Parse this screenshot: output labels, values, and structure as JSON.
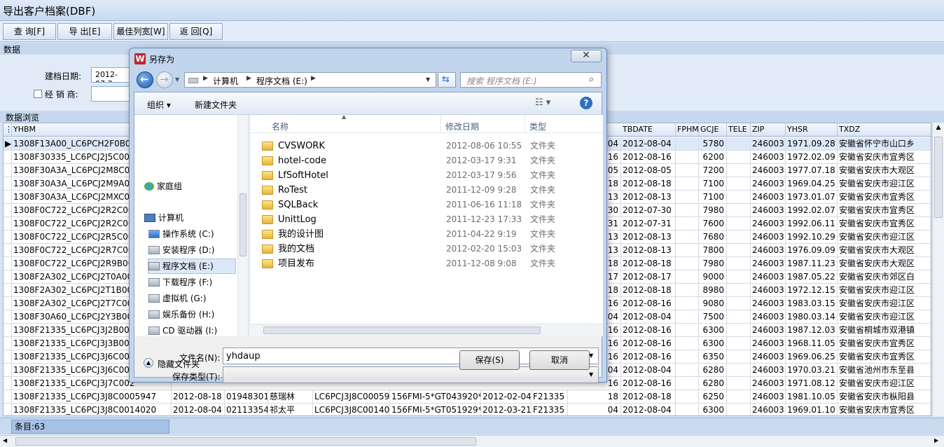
{
  "window": {
    "title": "导出客户档案(DBF)"
  },
  "toolbar": {
    "query_label": "查    询[F]",
    "export_label": "导    出[E]",
    "best_width_label": "最佳列宽[W]",
    "back_label": "返    回[Q]"
  },
  "data_section": {
    "title": "数据",
    "date_label": "建档日期:",
    "date_value": "2012-07-2",
    "dealer_label": "经 销 商:",
    "dealer_checked": false
  },
  "browse_section": {
    "title": "数据浏览"
  },
  "grid": {
    "left_columns": [
      "YHBM"
    ],
    "right_columns": [
      "TBDATE",
      "FPHM",
      "GCJE",
      "TELE",
      "ZIP",
      "YHSR",
      "TXDZ"
    ],
    "rows": [
      {
        "yhbm": "1308F13A00_LC6PCH2F0B001",
        "tb_tail": "04",
        "tbdate": "2012-08-04",
        "fphm": "",
        "gcje": "5780",
        "tele": "",
        "zip": "246003",
        "yhsr": "1971.09.28",
        "txdz": "安徽省怀宁市山口乡",
        "selected": true
      },
      {
        "yhbm": "1308F30335_LC6PCJ2J5C002",
        "tb_tail": "16",
        "tbdate": "2012-08-16",
        "fphm": "",
        "gcje": "6200",
        "tele": "",
        "zip": "246003",
        "yhsr": "1972.02.09",
        "txdz": "安徽省安庆市宜秀区"
      },
      {
        "yhbm": "1308F30A3A_LC6PCJ2M8C001",
        "tb_tail": "05",
        "tbdate": "2012-08-05",
        "fphm": "",
        "gcje": "7200",
        "tele": "",
        "zip": "246003",
        "yhsr": "1977.07.18",
        "txdz": "安徽省安庆市大观区"
      },
      {
        "yhbm": "1308F30A3A_LC6PCJ2M9A000",
        "tb_tail": "18",
        "tbdate": "2012-08-18",
        "fphm": "",
        "gcje": "7100",
        "tele": "",
        "zip": "246003",
        "yhsr": "1969.04.25",
        "txdz": "安徽省安庆市迎江区"
      },
      {
        "yhbm": "1308F30A3A_LC6PCJ2MXC001",
        "tb_tail": "13",
        "tbdate": "2012-08-13",
        "fphm": "",
        "gcje": "7100",
        "tele": "",
        "zip": "246003",
        "yhsr": "1973.01.07",
        "txdz": "安徽省安庆市宜秀区"
      },
      {
        "yhbm": "1308F0C722_LC6PCJ2R2C001",
        "tb_tail": "30",
        "tbdate": "2012-07-30",
        "fphm": "",
        "gcje": "7980",
        "tele": "",
        "zip": "246003",
        "yhsr": "1992.02.07",
        "txdz": "安徽省安庆市宜秀区"
      },
      {
        "yhbm": "1308F0C722_LC6PCJ2R2C001",
        "tb_tail": "31",
        "tbdate": "2012-07-31",
        "fphm": "",
        "gcje": "7600",
        "tele": "",
        "zip": "246003",
        "yhsr": "1992.06.11",
        "txdz": "安徽省安庆市宜秀区"
      },
      {
        "yhbm": "1308F0C722_LC6PCJ2R5C001",
        "tb_tail": "13",
        "tbdate": "2012-08-13",
        "fphm": "",
        "gcje": "7680",
        "tele": "",
        "zip": "246003",
        "yhsr": "1992.10.29",
        "txdz": "安徽省安庆市迎江区"
      },
      {
        "yhbm": "1308F0C722_LC6PCJ2R7C001",
        "tb_tail": "13",
        "tbdate": "2012-08-13",
        "fphm": "",
        "gcje": "7800",
        "tele": "",
        "zip": "246003",
        "yhsr": "1976.09.09",
        "txdz": "安徽省安庆市大观区"
      },
      {
        "yhbm": "1308F0C722_LC6PCJ2R9B005",
        "tb_tail": "18",
        "tbdate": "2012-08-18",
        "fphm": "",
        "gcje": "7980",
        "tele": "",
        "zip": "246003",
        "yhsr": "1987.11.23",
        "txdz": "安徽省安庆市大观区"
      },
      {
        "yhbm": "1308F2A302_LC6PCJ2T0A000",
        "tb_tail": "17",
        "tbdate": "2012-08-17",
        "fphm": "",
        "gcje": "9000",
        "tele": "",
        "zip": "246003",
        "yhsr": "1987.05.22",
        "txdz": "安徽省安庆市郊区白"
      },
      {
        "yhbm": "1308F2A302_LC6PCJ2T1B000",
        "tb_tail": "18",
        "tbdate": "2012-08-18",
        "fphm": "",
        "gcje": "8980",
        "tele": "",
        "zip": "246003",
        "yhsr": "1972.12.15",
        "txdz": "安徽省安庆市迎江区"
      },
      {
        "yhbm": "1308F2A302_LC6PCJ2T7C000",
        "tb_tail": "16",
        "tbdate": "2012-08-16",
        "fphm": "",
        "gcje": "9080",
        "tele": "",
        "zip": "246003",
        "yhsr": "1983.03.15",
        "txdz": "安徽省安庆市迎江区"
      },
      {
        "yhbm": "1308F30A60_LC6PCJ2Y3B004",
        "tb_tail": "04",
        "tbdate": "2012-08-04",
        "fphm": "",
        "gcje": "7500",
        "tele": "",
        "zip": "246003",
        "yhsr": "1980.03.14",
        "txdz": "安徽省安庆市迎江区"
      },
      {
        "yhbm": "1308F21335_LC6PCJ3J2B003",
        "tb_tail": "16",
        "tbdate": "2012-08-16",
        "fphm": "",
        "gcje": "6300",
        "tele": "",
        "zip": "246003",
        "yhsr": "1987.12.03",
        "txdz": "安徽省桐城市双港镇"
      },
      {
        "yhbm": "1308F21335_LC6PCJ3J3B003",
        "tb_tail": "16",
        "tbdate": "2012-08-16",
        "fphm": "",
        "gcje": "6300",
        "tele": "",
        "zip": "246003",
        "yhsr": "1968.11.05",
        "txdz": "安徽省安庆市宜秀区"
      },
      {
        "yhbm": "1308F21335_LC6PCJ3J6C000",
        "tb_tail": "16",
        "tbdate": "2012-08-16",
        "fphm": "",
        "gcje": "6350",
        "tele": "",
        "zip": "246003",
        "yhsr": "1969.06.25",
        "txdz": "安徽省安庆市宜秀区"
      },
      {
        "yhbm": "1308F21335_LC6PCJ3J6C000",
        "tb_tail": "04",
        "tbdate": "2012-08-04",
        "fphm": "",
        "gcje": "6280",
        "tele": "",
        "zip": "246003",
        "yhsr": "1970.03.21",
        "txdz": "安徽省池州市东至县"
      },
      {
        "yhbm": "1308F21335_LC6PCJ3J7C002",
        "tb_tail": "16",
        "tbdate": "2012-08-16",
        "fphm": "",
        "gcje": "6280",
        "tele": "",
        "zip": "246003",
        "yhsr": "1971.08.12",
        "txdz": "安徽省安庆市迎江区"
      },
      {
        "yhbm": "1308F21335_LC6PCJ3J8C0005947",
        "mid": [
          "2012-08-18",
          "01948301",
          "慈瑞林",
          "LC6PCJ3J8C0005947",
          "156FMI-5*GT043920*",
          "2012-02-04",
          "F21335"
        ],
        "tb_tail": "18",
        "tbdate": "2012-08-18",
        "fphm": "",
        "gcje": "6250",
        "tele": "",
        "zip": "246003",
        "yhsr": "1981.10.05",
        "txdz": "安徽省安庆市枞阳县"
      },
      {
        "yhbm": "1308F21335_LC6PCJ3J8C0014020",
        "mid": [
          "2012-08-04",
          "02113354",
          "祁太平",
          "LC6PCJ3J8C0014020",
          "156FMI-5*GT051929*",
          "2012-03-21",
          "F21335"
        ],
        "tb_tail": "04",
        "tbdate": "2012-08-04",
        "fphm": "",
        "gcje": "6300",
        "tele": "",
        "zip": "246003",
        "yhsr": "1969.01.10",
        "txdz": "安徽省安庆市宜秀区"
      }
    ]
  },
  "status": {
    "count_text": "条目:63"
  },
  "dialog": {
    "title": "另存为",
    "breadcrumb": [
      "计算机",
      "程序文档 (E:)"
    ],
    "search_placeholder": "搜索 程序文档 (E:)",
    "organize_label": "组织 ▾",
    "new_folder_label": "新建文件夹",
    "nav": {
      "homegroup": "家庭组",
      "computer": "计算机",
      "drives": [
        "操作系统 (C:)",
        "安装程序 (D:)",
        "程序文档 (E:)",
        "下载程序 (F:)",
        "虚拟机 (G:)",
        "娱乐备份 (H:)",
        "CD 驱动器 (I:)"
      ],
      "selected_drive": "程序文档 (E:)"
    },
    "columns": {
      "name": "名称",
      "date": "修改日期",
      "type": "类型"
    },
    "files": [
      {
        "name": "CVSWORK",
        "date": "2012-08-06 10:55",
        "type": "文件夹",
        "locked": true
      },
      {
        "name": "hotel-code",
        "date": "2012-03-17 9:31",
        "type": "文件夹"
      },
      {
        "name": "LfSoftHotel",
        "date": "2012-03-17 9:56",
        "type": "文件夹"
      },
      {
        "name": "RoTest",
        "date": "2011-12-09 9:28",
        "type": "文件夹"
      },
      {
        "name": "SQLBack",
        "date": "2011-06-16 11:18",
        "type": "文件夹"
      },
      {
        "name": "UnittLog",
        "date": "2011-12-23 17:33",
        "type": "文件夹"
      },
      {
        "name": "我的设计图",
        "date": "2011-04-22 9:19",
        "type": "文件夹"
      },
      {
        "name": "我的文档",
        "date": "2012-02-20 15:03",
        "type": "文件夹"
      },
      {
        "name": "项目发布",
        "date": "2011-12-08 9:08",
        "type": "文件夹"
      }
    ],
    "filename_label": "文件名(N):",
    "filename_value": "yhdaup",
    "filetype_label": "保存类型(T):",
    "filetype_value": "",
    "hide_folders_label": "隐藏文件夹",
    "save_label": "保存(S)",
    "cancel_label": "取消"
  },
  "colors": {
    "accent": "#3a75c4",
    "selection": "#dde9f8",
    "title_bg": "#c8daf0"
  }
}
